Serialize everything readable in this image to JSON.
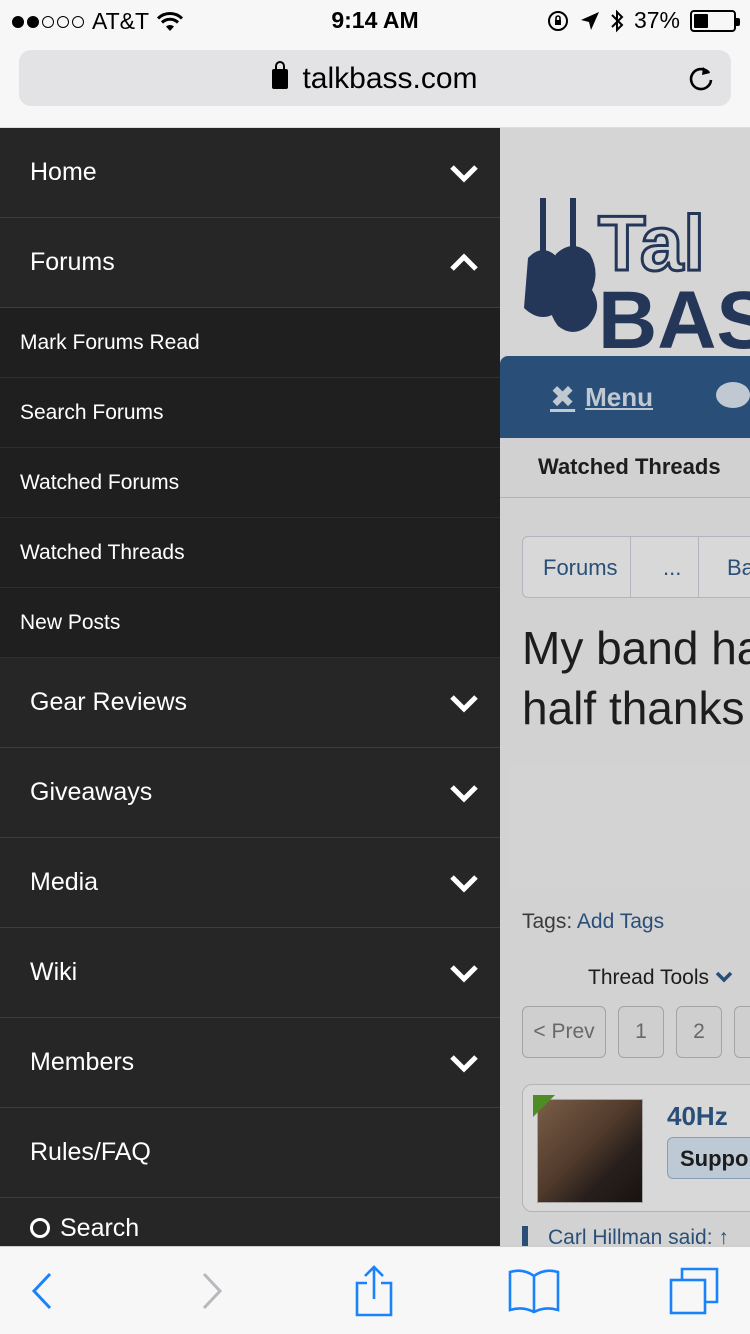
{
  "status_bar": {
    "carrier": "AT&T",
    "time": "9:14 AM",
    "battery": "37%",
    "battery_level": 0.37,
    "signal_bars_filled": 2,
    "signal_bars_total": 5
  },
  "browser": {
    "url": "talkbass.com"
  },
  "side_menu": {
    "items": [
      {
        "label": "Home",
        "expanded": false
      },
      {
        "label": "Forums",
        "expanded": true
      },
      {
        "label": "Gear Reviews",
        "expanded": false
      },
      {
        "label": "Giveaways",
        "expanded": false
      },
      {
        "label": "Media",
        "expanded": false
      },
      {
        "label": "Wiki",
        "expanded": false
      },
      {
        "label": "Members",
        "expanded": false
      },
      {
        "label": "Rules/FAQ"
      }
    ],
    "forums_submenu": [
      "Mark Forums Read",
      "Search Forums",
      "Watched Forums",
      "Watched Threads",
      "New Posts"
    ],
    "search_label": "Search"
  },
  "page": {
    "logo_text_top": "Tal",
    "logo_text_bottom": "BAS",
    "nav_menu_label": "Menu",
    "tab_label": "Watched Threads",
    "breadcrumb": [
      "Forums",
      "...",
      "Ba"
    ],
    "thread_title_line1": "My band ha",
    "thread_title_line2": "half thanks",
    "tags_label": "Tags:",
    "tags_link": "Add Tags",
    "thread_tools": "Thread Tools",
    "pager": [
      "< Prev",
      "1",
      "2"
    ],
    "poster_name": "40Hz",
    "poster_badge": "Suppo",
    "quote_text": "Carl Hillman said: ↑"
  },
  "colors": {
    "menu_bg": "#262626",
    "submenu_bg": "#1f1f1f",
    "accent": "#2f5a8a",
    "ios_blue": "#1a82fb"
  }
}
